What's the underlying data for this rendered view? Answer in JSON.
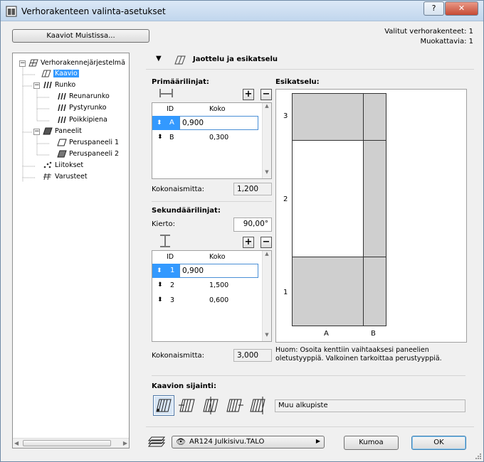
{
  "window": {
    "title": "Verhorakenteen valinta-asetukset"
  },
  "titlebar": {
    "help": "?",
    "close": "✕"
  },
  "header": {
    "favorites_button": "Kaaviot Muistissa...",
    "selected_count": "Valitut verhorakenteet: 1",
    "editable_count": "Muokattavia: 1"
  },
  "tree": {
    "root": "Verhorakennejärjestelmä",
    "items": [
      {
        "label": "Kaavio",
        "selected": true
      },
      {
        "label": "Runko"
      },
      {
        "label": "Reunarunko"
      },
      {
        "label": "Pystyrunko"
      },
      {
        "label": "Poikkipiena"
      },
      {
        "label": "Paneelit"
      },
      {
        "label": "Peruspaneeli 1"
      },
      {
        "label": "Peruspaneeli 2"
      },
      {
        "label": "Liitokset"
      },
      {
        "label": "Varusteet"
      }
    ],
    "toggle_minus": "−"
  },
  "section": {
    "title": "Jaottelu ja esikatselu"
  },
  "primary": {
    "title": "Primäärilinjat:",
    "col_id": "ID",
    "col_size": "Koko",
    "rows": [
      {
        "id": "A",
        "size": "0,900"
      },
      {
        "id": "B",
        "size": "0,300"
      }
    ],
    "total_label": "Kokonaismitta:",
    "total_value": "1,200"
  },
  "secondary": {
    "title": "Sekundäärilinjat:",
    "rotation_label": "Kierto:",
    "rotation_value": "90,00°",
    "col_id": "ID",
    "col_size": "Koko",
    "rows": [
      {
        "id": "1",
        "size": "0,900"
      },
      {
        "id": "2",
        "size": "1,500"
      },
      {
        "id": "3",
        "size": "0,600"
      }
    ],
    "total_label": "Kokonaismitta:",
    "total_value": "3,000"
  },
  "preview": {
    "title": "Esikatselu:",
    "row_labels": [
      "3",
      "2",
      "1"
    ],
    "col_labels": [
      "A",
      "B"
    ],
    "hint": "Huom: Osoita kenttiin vaihtaaksesi paneelien oletustyyppiä. Valkoinen tarkoittaa perustyyppiä."
  },
  "location": {
    "title": "Kaavion sijainti:",
    "value": "Muu alkupiste"
  },
  "footer": {
    "layer": "AR124 Julkisivu.TALO",
    "cancel": "Kumoa",
    "ok": "OK"
  },
  "colors": {
    "selection": "#3399ff",
    "panel_gray": "#cfcfcf"
  }
}
